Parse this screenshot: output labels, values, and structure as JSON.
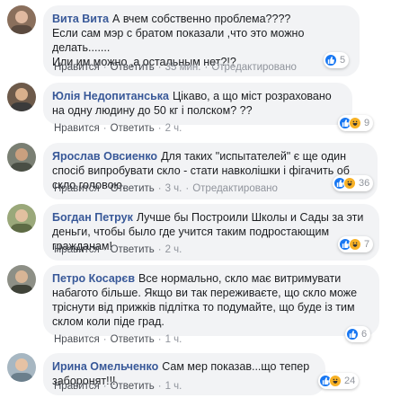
{
  "comments": [
    {
      "author": "Вита Вита",
      "text": "А вчем собственно проблема????\nЕсли сам мэр с братом показали ,что это можно делать.......\nИли им можно ,а остальным нет?!?",
      "like_label": "Нравится",
      "reply_label": "Ответить",
      "time": "35 мин.",
      "edited": "Отредактировано",
      "reaction_count": "5",
      "reactions": [
        "like-icon"
      ]
    },
    {
      "author": "Юлія Недопитанська",
      "text": "Цікаво, а що міст розраховано на одну людину до 50 кг і полском? ??",
      "like_label": "Нравится",
      "reply_label": "Ответить",
      "time": "2 ч.",
      "edited": "",
      "reaction_count": "9",
      "reactions": [
        "like-icon",
        "haha-icon"
      ]
    },
    {
      "author": "Ярослав Овсиенко",
      "text": "Для таких \"испытателей\" є ще один спосіб випробувати скло - стати навколішки і фігачить об скло головою.",
      "like_label": "Нравится",
      "reply_label": "Ответить",
      "time": "3 ч.",
      "edited": "Отредактировано",
      "reaction_count": "36",
      "reactions": [
        "like-icon",
        "haha-icon"
      ]
    },
    {
      "author": "Богдан Петрук",
      "text": "Лучше бы Построили Школы и Сады за эти деньги, чтобы было где учится таким подростающим гражданам!",
      "like_label": "Нравится",
      "reply_label": "Ответить",
      "time": "2 ч.",
      "edited": "",
      "reaction_count": "7",
      "reactions": [
        "like-icon",
        "haha-icon"
      ]
    },
    {
      "author": "Петро Косарєв",
      "text": "Все нормально, скло має витримувати набагото більше. Якщо ви так переживаєте, що скло може трісн​ути від прижків підлітка то подумайте, що буде із тим склом коли піде град.",
      "like_label": "Нравится",
      "reply_label": "Ответить",
      "time": "1 ч.",
      "edited": "",
      "reaction_count": "6",
      "reactions": [
        "like-icon"
      ]
    },
    {
      "author": "Ирина Омельченко",
      "text": "Сам мер показав...що тепер заборонят!!!",
      "like_label": "Нравится",
      "reply_label": "Ответить",
      "time": "1 ч.",
      "edited": "",
      "reaction_count": "24",
      "reactions": [
        "like-icon",
        "haha-icon"
      ]
    }
  ],
  "colors": {
    "author": "#385898",
    "bubble": "#f2f3f5",
    "like": "#1877f2",
    "haha": "#f7b125",
    "meta": "#90949c"
  }
}
